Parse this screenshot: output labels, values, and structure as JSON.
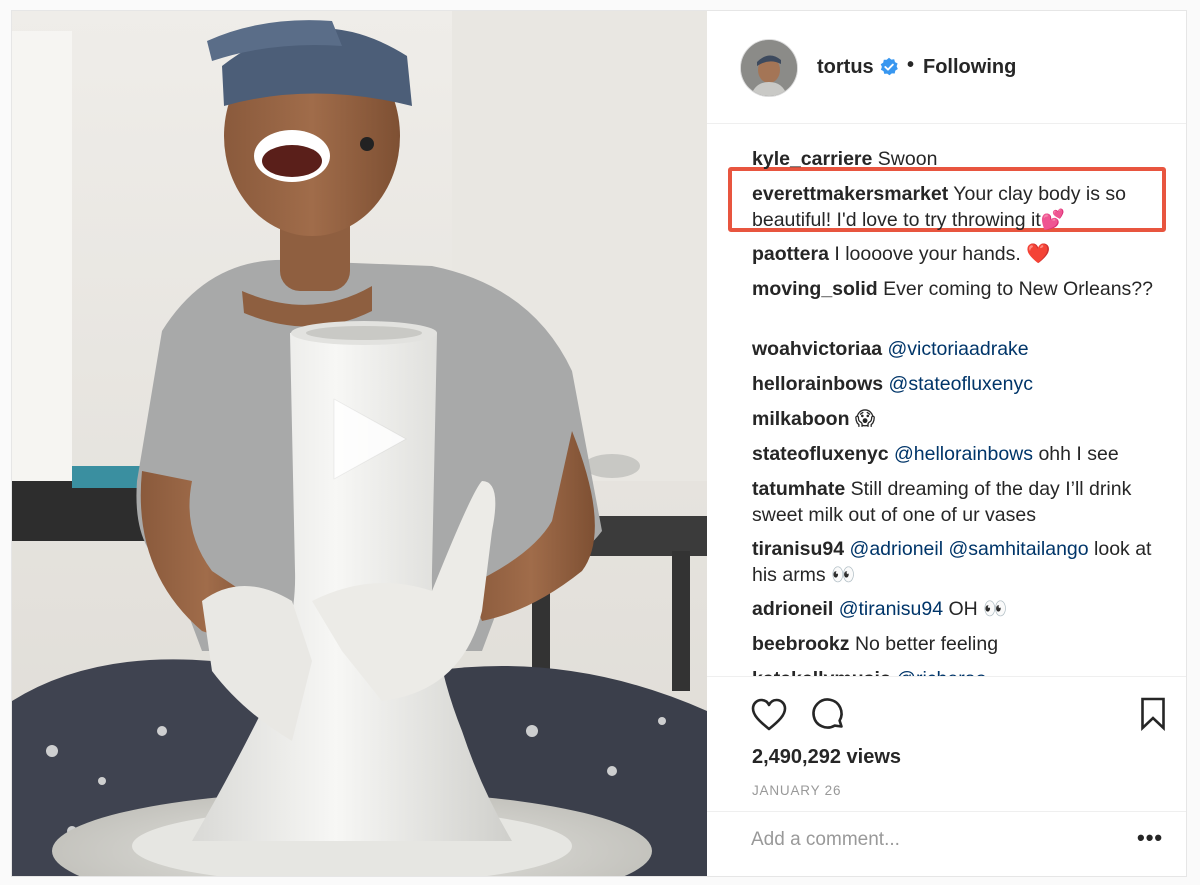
{
  "post": {
    "author": {
      "username": "tortus",
      "verified": true,
      "follow_status": "Following"
    },
    "partial_comment_top": "",
    "comments": [
      {
        "user": "kyle_carriere",
        "parts": [
          {
            "t": "text",
            "v": " Swoon"
          }
        ]
      },
      {
        "user": "everettmakersmarket",
        "parts": [
          {
            "t": "text",
            "v": " Your clay body is so beautiful! I'd love to try throwing it💕"
          }
        ],
        "highlighted": true
      },
      {
        "user": "paottera",
        "parts": [
          {
            "t": "text",
            "v": " I loooove your hands. ❤️"
          }
        ]
      },
      {
        "user": "moving_solid",
        "parts": [
          {
            "t": "text",
            "v": " Ever coming to New Orleans??"
          }
        ]
      },
      {
        "user": "woahvictoriaa",
        "parts": [
          {
            "t": "text",
            "v": " "
          },
          {
            "t": "mention",
            "v": "@victoriaadrake"
          }
        ]
      },
      {
        "user": "hellorainbows",
        "parts": [
          {
            "t": "text",
            "v": " "
          },
          {
            "t": "mention",
            "v": "@stateofluxenyc"
          }
        ]
      },
      {
        "user": "milkaboon",
        "parts": [
          {
            "t": "text",
            "v": " 😱"
          }
        ]
      },
      {
        "user": "stateofluxenyc",
        "parts": [
          {
            "t": "text",
            "v": " "
          },
          {
            "t": "mention",
            "v": "@hellorainbows"
          },
          {
            "t": "text",
            "v": " ohh I see"
          }
        ]
      },
      {
        "user": "tatumhate",
        "parts": [
          {
            "t": "text",
            "v": " Still dreaming of the day I’ll drink sweet milk out of one of ur vases"
          }
        ]
      },
      {
        "user": "tiranisu94",
        "parts": [
          {
            "t": "text",
            "v": " "
          },
          {
            "t": "mention",
            "v": "@adrioneil"
          },
          {
            "t": "text",
            "v": " "
          },
          {
            "t": "mention",
            "v": "@samhitailango"
          },
          {
            "t": "text",
            "v": " look at his arms 👀"
          }
        ]
      },
      {
        "user": "adrioneil",
        "parts": [
          {
            "t": "text",
            "v": " "
          },
          {
            "t": "mention",
            "v": "@tiranisu94"
          },
          {
            "t": "text",
            "v": " OH 👀"
          }
        ]
      },
      {
        "user": "beebrookz",
        "parts": [
          {
            "t": "text",
            "v": " No better feeling"
          }
        ]
      },
      {
        "user": "katekellymusic",
        "parts": [
          {
            "t": "text",
            "v": " "
          },
          {
            "t": "mention",
            "v": "@richerao"
          }
        ]
      }
    ],
    "actions": {
      "like_icon": "heart-icon",
      "comment_icon": "comment-bubble-icon",
      "save_icon": "bookmark-icon"
    },
    "views": "2,490,292 views",
    "date": "JANUARY 26",
    "add_comment": {
      "placeholder": "Add a comment...",
      "more_label": "•••"
    }
  },
  "colors": {
    "highlight_border": "#e8553f",
    "mention": "#003569",
    "verified": "#3897f0"
  }
}
